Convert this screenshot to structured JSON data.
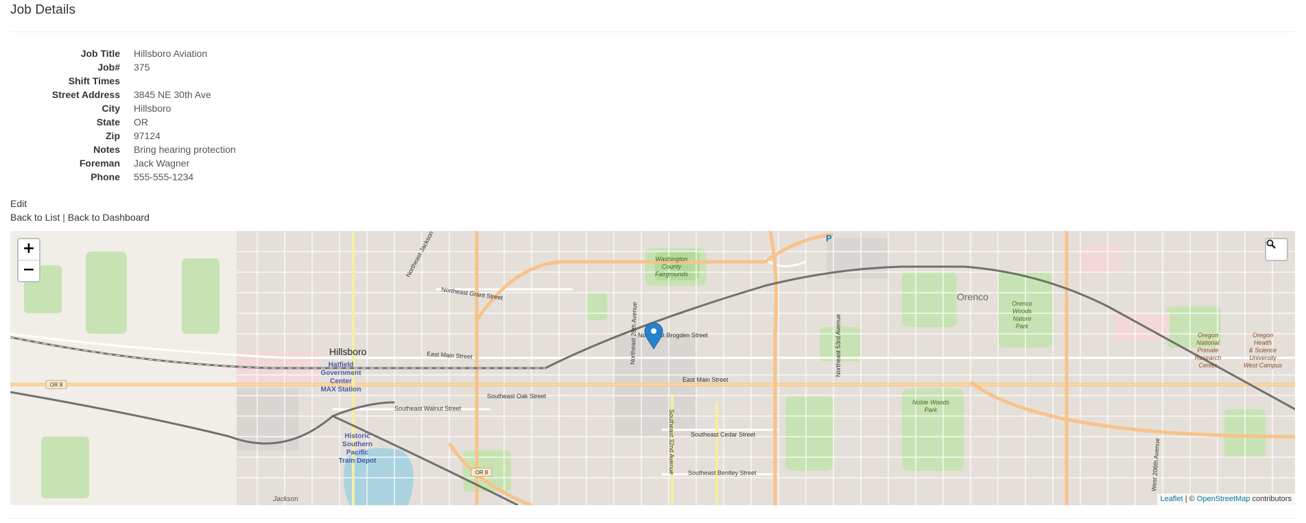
{
  "page": {
    "title": "Job Details"
  },
  "details": [
    {
      "label": "Job Title",
      "value": "Hillsboro Aviation"
    },
    {
      "label": "Job#",
      "value": "375"
    },
    {
      "label": "Shift Times",
      "value": ""
    },
    {
      "label": "Street Address",
      "value": "3845 NE 30th Ave"
    },
    {
      "label": "City",
      "value": "Hillsboro"
    },
    {
      "label": "State",
      "value": "OR"
    },
    {
      "label": "Zip",
      "value": "97124"
    },
    {
      "label": "Notes",
      "value": "Bring hearing protection"
    },
    {
      "label": "Foreman",
      "value": "Jack Wagner"
    },
    {
      "label": "Phone",
      "value": "555-555-1234"
    }
  ],
  "links": {
    "edit": "Edit",
    "back_to_list": "Back to List",
    "separator": "|",
    "back_to_dashboard": "Back to Dashboard"
  },
  "map": {
    "zoom_in": "+",
    "zoom_out": "−",
    "attribution": {
      "leaflet": "Leaflet",
      "sep": "| ©",
      "osm": "OpenStreetMap",
      "contributors": "contributors"
    },
    "labels": {
      "hillsboro": "Hillsboro",
      "orenco": "Orenco",
      "hatfield_1": "Hatfield",
      "hatfield_2": "Government",
      "hatfield_3": "Center",
      "hatfield_4": "MAX Station",
      "historic_1": "Historic",
      "historic_2": "Southern",
      "historic_3": "Pacific",
      "historic_4": "Train Depot",
      "fair_1": "Washington",
      "fair_2": "County",
      "fair_3": "Fairgrounds",
      "orenco_woods_1": "Orenco",
      "orenco_woods_2": "Woods",
      "orenco_woods_3": "Nature",
      "orenco_woods_4": "Park",
      "noble_1": "Noble Woods",
      "noble_2": "Park",
      "primate_1": "Oregon",
      "primate_2": "National",
      "primate_3": "Primate",
      "primate_4": "Research",
      "primate_5": "Center",
      "ohsu_1": "Oregon",
      "ohsu_2": "Health",
      "ohsu_3": "& Science",
      "ohsu_4": "University",
      "ohsu_5": "West Campus",
      "ne_grant": "Northeast Grant Street",
      "ne_jackson": "Northeast Jackson",
      "ne_brogden": "Northeast Brogden Street",
      "ne_28th": "Northeast 28th Avenue",
      "ne_53rd": "Northeast 53rd Avenue",
      "e_main_1": "East Main Street",
      "e_main_2": "East Main Street",
      "se_oak": "Southeast Oak Street",
      "se_walnut": "Southeast Walnut Street",
      "se_cedar": "Southeast Cedar Street",
      "se_bentley": "Southeast Bentley Street",
      "se_32nd": "Southeast 32nd Avenue",
      "w_206th": "West 206th Avenue",
      "or8_1": "OR 8",
      "or8_2": "OR 8",
      "jackson_bottom": "Jackson",
      "parking": "P"
    }
  },
  "colors": {
    "link": "#0078a8",
    "marker": "#2a81cb",
    "major_road": "#f7c38a",
    "rail": "#707070",
    "park": "#c9e6b5"
  }
}
